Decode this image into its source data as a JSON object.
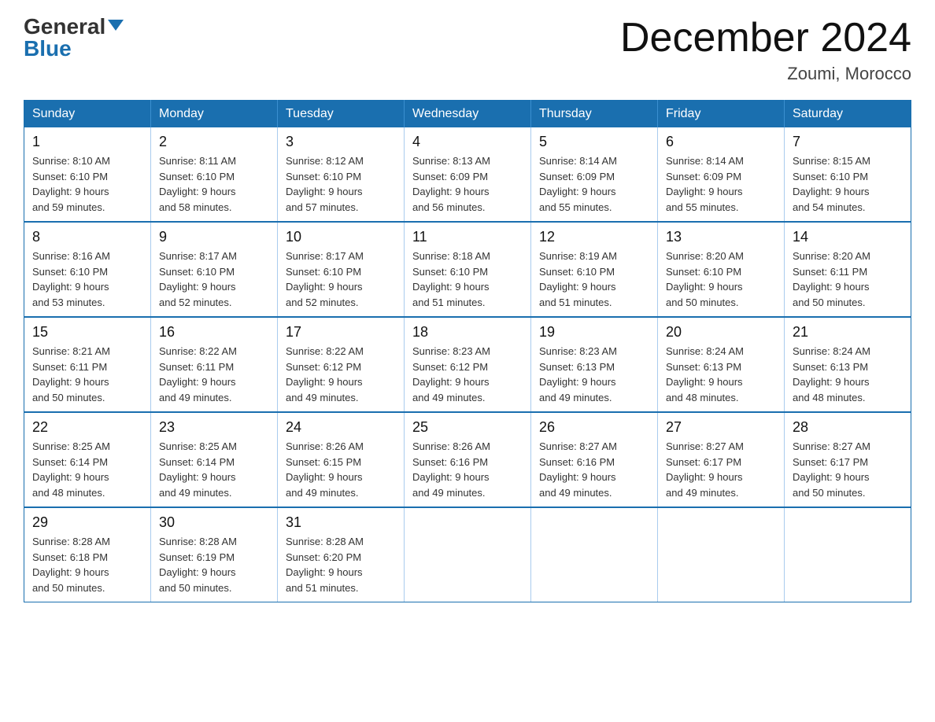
{
  "header": {
    "logo_general": "General",
    "logo_blue": "Blue",
    "month_title": "December 2024",
    "location": "Zoumi, Morocco"
  },
  "days_of_week": [
    "Sunday",
    "Monday",
    "Tuesday",
    "Wednesday",
    "Thursday",
    "Friday",
    "Saturday"
  ],
  "weeks": [
    [
      {
        "day": "1",
        "sunrise": "8:10 AM",
        "sunset": "6:10 PM",
        "daylight": "9 hours and 59 minutes."
      },
      {
        "day": "2",
        "sunrise": "8:11 AM",
        "sunset": "6:10 PM",
        "daylight": "9 hours and 58 minutes."
      },
      {
        "day": "3",
        "sunrise": "8:12 AM",
        "sunset": "6:10 PM",
        "daylight": "9 hours and 57 minutes."
      },
      {
        "day": "4",
        "sunrise": "8:13 AM",
        "sunset": "6:09 PM",
        "daylight": "9 hours and 56 minutes."
      },
      {
        "day": "5",
        "sunrise": "8:14 AM",
        "sunset": "6:09 PM",
        "daylight": "9 hours and 55 minutes."
      },
      {
        "day": "6",
        "sunrise": "8:14 AM",
        "sunset": "6:09 PM",
        "daylight": "9 hours and 55 minutes."
      },
      {
        "day": "7",
        "sunrise": "8:15 AM",
        "sunset": "6:10 PM",
        "daylight": "9 hours and 54 minutes."
      }
    ],
    [
      {
        "day": "8",
        "sunrise": "8:16 AM",
        "sunset": "6:10 PM",
        "daylight": "9 hours and 53 minutes."
      },
      {
        "day": "9",
        "sunrise": "8:17 AM",
        "sunset": "6:10 PM",
        "daylight": "9 hours and 52 minutes."
      },
      {
        "day": "10",
        "sunrise": "8:17 AM",
        "sunset": "6:10 PM",
        "daylight": "9 hours and 52 minutes."
      },
      {
        "day": "11",
        "sunrise": "8:18 AM",
        "sunset": "6:10 PM",
        "daylight": "9 hours and 51 minutes."
      },
      {
        "day": "12",
        "sunrise": "8:19 AM",
        "sunset": "6:10 PM",
        "daylight": "9 hours and 51 minutes."
      },
      {
        "day": "13",
        "sunrise": "8:20 AM",
        "sunset": "6:10 PM",
        "daylight": "9 hours and 50 minutes."
      },
      {
        "day": "14",
        "sunrise": "8:20 AM",
        "sunset": "6:11 PM",
        "daylight": "9 hours and 50 minutes."
      }
    ],
    [
      {
        "day": "15",
        "sunrise": "8:21 AM",
        "sunset": "6:11 PM",
        "daylight": "9 hours and 50 minutes."
      },
      {
        "day": "16",
        "sunrise": "8:22 AM",
        "sunset": "6:11 PM",
        "daylight": "9 hours and 49 minutes."
      },
      {
        "day": "17",
        "sunrise": "8:22 AM",
        "sunset": "6:12 PM",
        "daylight": "9 hours and 49 minutes."
      },
      {
        "day": "18",
        "sunrise": "8:23 AM",
        "sunset": "6:12 PM",
        "daylight": "9 hours and 49 minutes."
      },
      {
        "day": "19",
        "sunrise": "8:23 AM",
        "sunset": "6:13 PM",
        "daylight": "9 hours and 49 minutes."
      },
      {
        "day": "20",
        "sunrise": "8:24 AM",
        "sunset": "6:13 PM",
        "daylight": "9 hours and 48 minutes."
      },
      {
        "day": "21",
        "sunrise": "8:24 AM",
        "sunset": "6:13 PM",
        "daylight": "9 hours and 48 minutes."
      }
    ],
    [
      {
        "day": "22",
        "sunrise": "8:25 AM",
        "sunset": "6:14 PM",
        "daylight": "9 hours and 48 minutes."
      },
      {
        "day": "23",
        "sunrise": "8:25 AM",
        "sunset": "6:14 PM",
        "daylight": "9 hours and 49 minutes."
      },
      {
        "day": "24",
        "sunrise": "8:26 AM",
        "sunset": "6:15 PM",
        "daylight": "9 hours and 49 minutes."
      },
      {
        "day": "25",
        "sunrise": "8:26 AM",
        "sunset": "6:16 PM",
        "daylight": "9 hours and 49 minutes."
      },
      {
        "day": "26",
        "sunrise": "8:27 AM",
        "sunset": "6:16 PM",
        "daylight": "9 hours and 49 minutes."
      },
      {
        "day": "27",
        "sunrise": "8:27 AM",
        "sunset": "6:17 PM",
        "daylight": "9 hours and 49 minutes."
      },
      {
        "day": "28",
        "sunrise": "8:27 AM",
        "sunset": "6:17 PM",
        "daylight": "9 hours and 50 minutes."
      }
    ],
    [
      {
        "day": "29",
        "sunrise": "8:28 AM",
        "sunset": "6:18 PM",
        "daylight": "9 hours and 50 minutes."
      },
      {
        "day": "30",
        "sunrise": "8:28 AM",
        "sunset": "6:19 PM",
        "daylight": "9 hours and 50 minutes."
      },
      {
        "day": "31",
        "sunrise": "8:28 AM",
        "sunset": "6:20 PM",
        "daylight": "9 hours and 51 minutes."
      },
      null,
      null,
      null,
      null
    ]
  ]
}
